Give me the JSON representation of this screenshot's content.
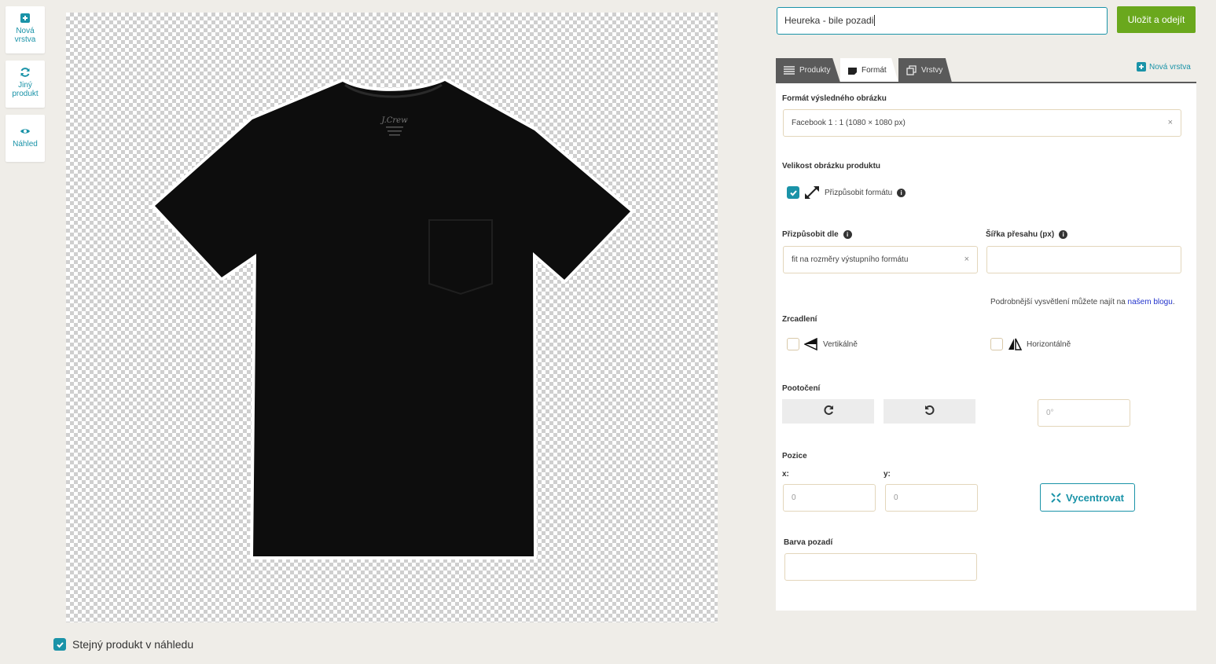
{
  "sidebar": {
    "new_layer": "Nová vrstva",
    "other_product": "Jiný produkt",
    "preview": "Náhled"
  },
  "canvas": {
    "same_product_label": "Stejný produkt v náhledu",
    "same_product_checked": true
  },
  "header": {
    "name_value": "Heureka - bile pozadi",
    "save_label": "Uložit a odejít"
  },
  "tabs": [
    {
      "label": "Produkty",
      "icon": "list-icon"
    },
    {
      "label": "Formát",
      "icon": "format-icon",
      "active": true
    },
    {
      "label": "Vrstvy",
      "icon": "layers-icon"
    }
  ],
  "new_layer_link": "Nová vrstva",
  "format": {
    "output_label": "Formát výsledného obrázku",
    "output_value": "Facebook 1 : 1 (1080 × 1080 px)",
    "size_label": "Velikost obrázku produktu",
    "fit_label": "Přizpůsobit formátu",
    "fit_checked": true,
    "fit_by_label": "Přizpůsobit dle",
    "fit_by_value": "fit na rozměry výstupního formátu",
    "overflow_label": "Šířka přesahu (px)",
    "overflow_value": "",
    "blog_text": "Podrobnější vysvětlení můžete najít na",
    "blog_link": "našem blogu",
    "blog_dot": ".",
    "mirror_label": "Zrcadlení",
    "vertical_label": "Vertikálně",
    "horizontal_label": "Horizontálně",
    "rotation_label": "Pootočení",
    "rotation_placeholder": "0°",
    "position_label": "Pozice",
    "x_label": "x:",
    "y_label": "y:",
    "x_placeholder": "0",
    "y_placeholder": "0",
    "center_label": "Vycentrovat",
    "bg_label": "Barva pozadí",
    "bg_value": ""
  },
  "colors": {
    "accent": "#1a93a8",
    "save": "#6aa81d",
    "tab_dark": "#5a5a5a",
    "field_border": "#e3d6bb"
  }
}
